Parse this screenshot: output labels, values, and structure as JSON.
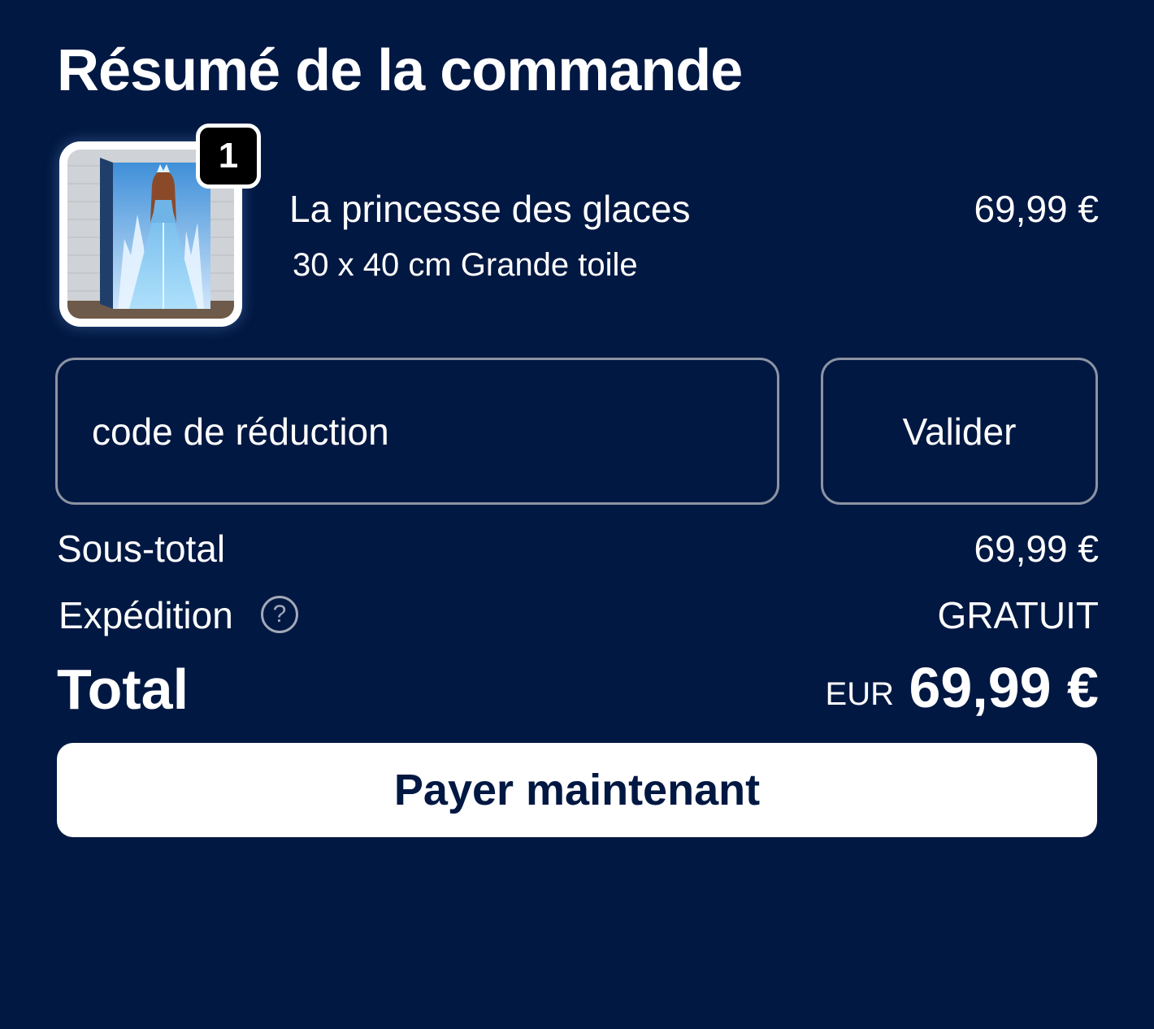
{
  "header": {
    "title": "Résumé de la commande"
  },
  "cart_item": {
    "quantity": "1",
    "name": "La princesse des glaces",
    "variant": "30 x 40 cm Grande toile",
    "price": "69,99 €"
  },
  "discount": {
    "placeholder": "code de réduction",
    "value": "",
    "apply_label": "Valider"
  },
  "summary": {
    "subtotal_label": "Sous-total",
    "subtotal_value": "69,99 €",
    "shipping_label": "Expédition",
    "shipping_help_icon": "question-circle-icon",
    "shipping_value": "GRATUIT",
    "total_label": "Total",
    "total_currency": "EUR",
    "total_value": "69,99 €"
  },
  "checkout": {
    "pay_label": "Payer maintenant"
  },
  "colors": {
    "background": "#011842",
    "text": "#ffffff",
    "border": "#8c93a3",
    "button_bg": "#ffffff",
    "button_text": "#011842"
  }
}
